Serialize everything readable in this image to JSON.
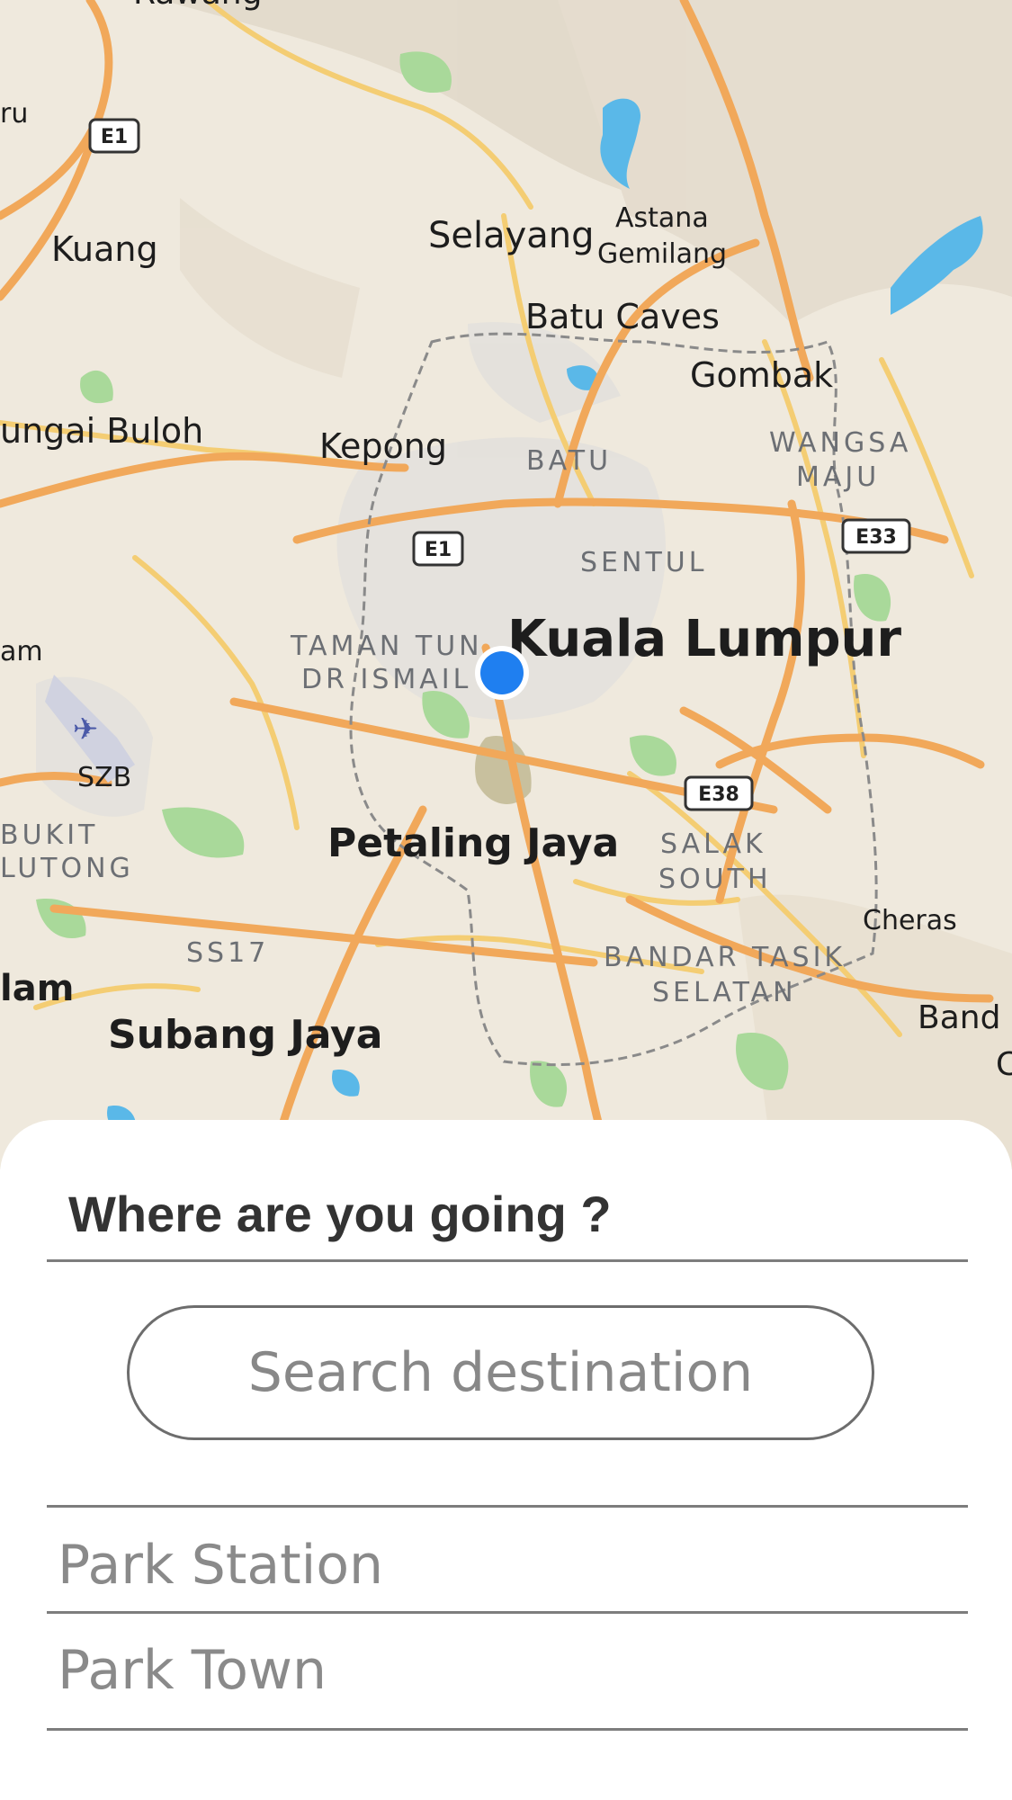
{
  "map": {
    "city_labels": {
      "kuala_lumpur": "Kuala Lumpur",
      "petaling_jaya": "Petaling Jaya",
      "subang_jaya": "Subang Jaya",
      "selayang": "Selayang",
      "kepong": "Kepong",
      "kuang": "Kuang",
      "gombak": "Gombak",
      "batu_caves": "Batu Caves",
      "cheras": "Cheras",
      "sungai_buloh": "ungai Buloh",
      "rawang": "Rawang",
      "astana_1": "Astana",
      "astana_2": "Gemilang",
      "ru": "ru",
      "am": "am",
      "lam": "lam",
      "bandar_partial": "Band",
      "c_partial": "C"
    },
    "district_labels": {
      "batu": "BATU",
      "sentul": "SENTUL",
      "wangsa_1": "WANGSA",
      "wangsa_2": "MAJU",
      "ttdi_1": "TAMAN TUN",
      "ttdi_2": "DR ISMAIL",
      "bukit_1": "BUKIT",
      "bukit_2": "LUTONG",
      "salak_1": "SALAK",
      "salak_2": "SOUTH",
      "btasik_1": "BANDAR TASIK",
      "btasik_2": "SELATAN",
      "ss17": "SS17"
    },
    "airport_code": "SZB",
    "highway_shields": {
      "e1_north": "E1",
      "e1_center": "E1",
      "e33": "E33",
      "e38": "E38"
    },
    "colors": {
      "land": "#efe9dd",
      "road_major": "#f1a85a",
      "road_minor": "#f4cd73",
      "water": "#5ab8e8",
      "park": "#a9d99a",
      "location_dot": "#1f7ff0"
    }
  },
  "sheet": {
    "title": "Where are you going ?",
    "search": {
      "placeholder": "Search destination",
      "value": ""
    },
    "suggestions": [
      {
        "label": "Park Station"
      },
      {
        "label": "Park Town"
      }
    ]
  }
}
